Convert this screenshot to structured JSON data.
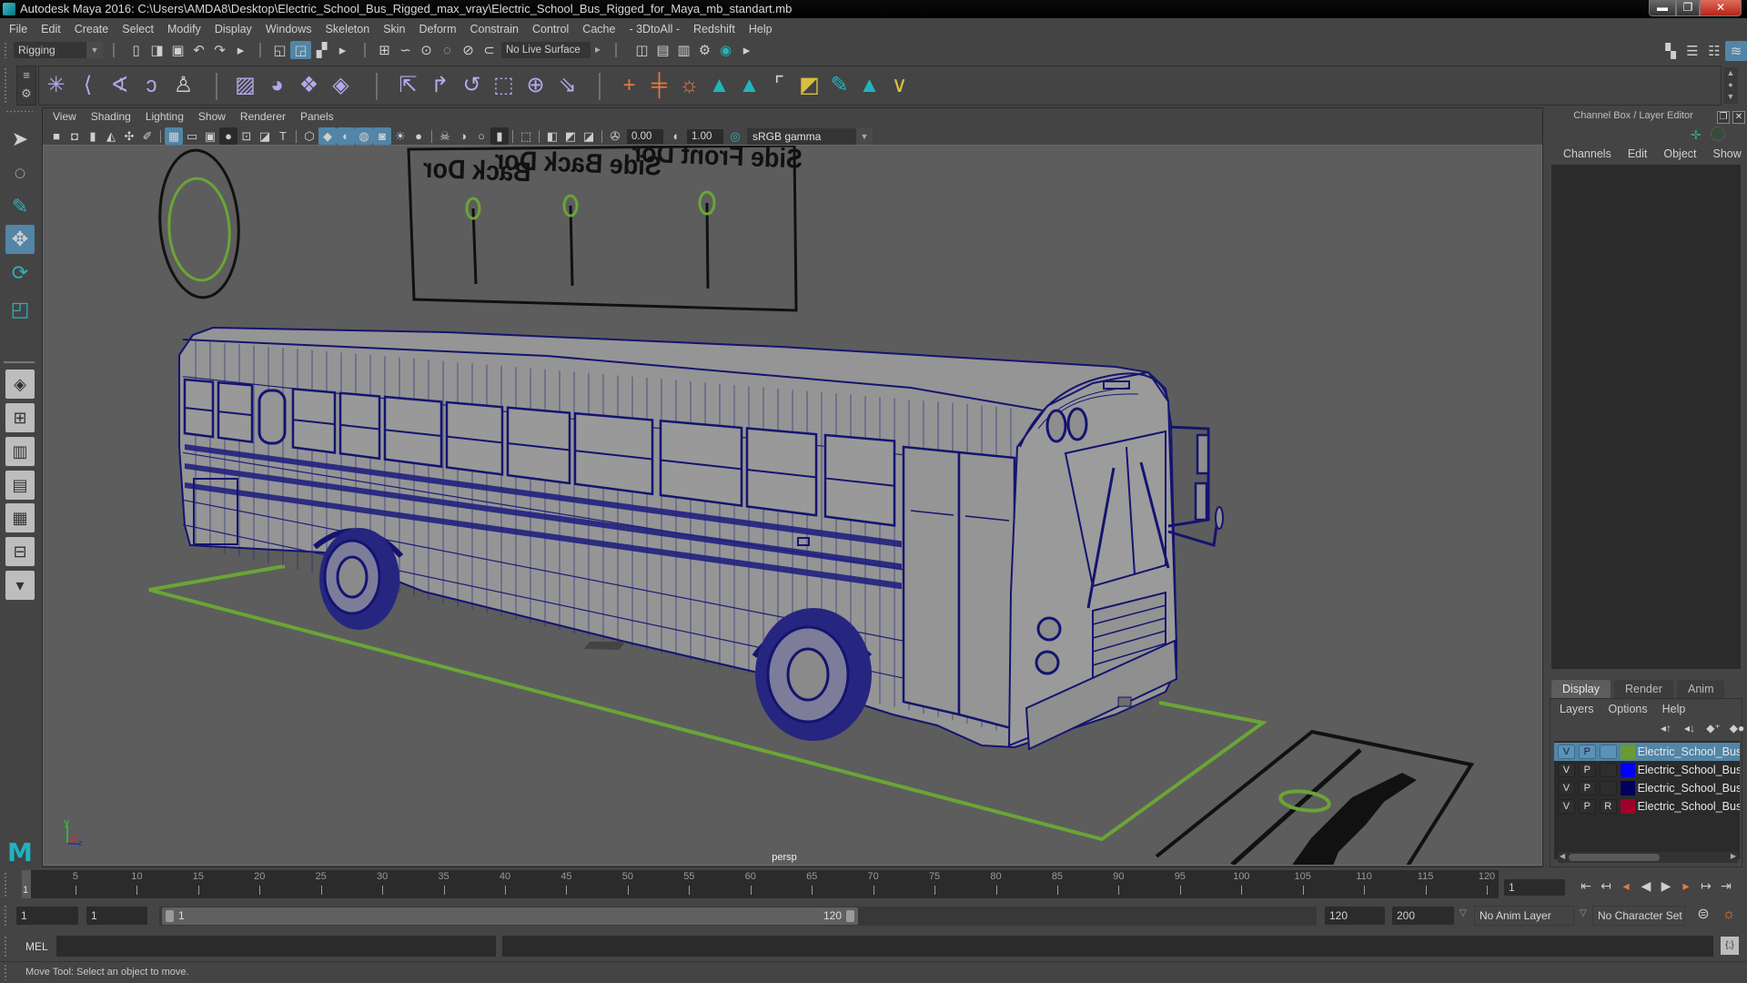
{
  "window": {
    "title": "Autodesk Maya 2016: C:\\Users\\AMDA8\\Desktop\\Electric_School_Bus_Rigged_max_vray\\Electric_School_Bus_Rigged_for_Maya_mb_standart.mb",
    "minimize": "▬",
    "restore": "❐",
    "close": "✕"
  },
  "menubar": [
    "File",
    "Edit",
    "Create",
    "Select",
    "Modify",
    "Display",
    "Windows",
    "Skeleton",
    "Skin",
    "Deform",
    "Constrain",
    "Control",
    "Cache",
    "- 3DtoAll -",
    "Redshift",
    "Help"
  ],
  "status_line": {
    "mode": "Rigging",
    "live_surface": "No Live Surface",
    "file_icons": [
      {
        "icon": "new-scene-icon",
        "tint": "gray"
      },
      {
        "icon": "open-scene-icon",
        "tint": "gray"
      },
      {
        "icon": "save-scene-icon",
        "tint": "gray"
      },
      {
        "icon": "undo-icon",
        "tint": "gray"
      },
      {
        "icon": "redo-icon",
        "tint": "gray"
      },
      {
        "icon": "expand-arrow-icon",
        "tint": "gray"
      }
    ],
    "select_icons": [
      {
        "icon": "select-by-hierarchy-icon",
        "tint": "gray"
      },
      {
        "icon": "select-by-object-icon",
        "tint": "gray",
        "active": true
      },
      {
        "icon": "select-by-component-icon",
        "tint": "gray"
      },
      {
        "icon": "expand-arrow-icon",
        "tint": "gray"
      }
    ],
    "snap_icons": [
      {
        "icon": "snap-to-grid-icon",
        "tint": "gray"
      },
      {
        "icon": "snap-to-curve-icon",
        "tint": "gray"
      },
      {
        "icon": "snap-to-point-icon",
        "tint": "gray"
      },
      {
        "icon": "snap-to-projected-center-icon",
        "tint": "gray"
      },
      {
        "icon": "snap-to-view-plane-icon",
        "tint": "gray"
      },
      {
        "icon": "make-live-icon",
        "tint": "gray"
      }
    ],
    "render_icons": [
      {
        "icon": "render-view-icon",
        "tint": "gray"
      },
      {
        "icon": "render-current-frame-icon",
        "tint": "gray"
      },
      {
        "icon": "ipr-render-icon",
        "tint": "gray"
      },
      {
        "icon": "render-settings-icon",
        "tint": "gray"
      },
      {
        "icon": "hypershade-icon",
        "tint": "teal"
      },
      {
        "icon": "expand-arrow-icon",
        "tint": "gray"
      }
    ],
    "panel_icons": [
      {
        "icon": "modeling-toolkit-icon",
        "tint": "gray"
      },
      {
        "icon": "attribute-editor-icon",
        "tint": "gray"
      },
      {
        "icon": "tool-settings-icon",
        "tint": "gray"
      },
      {
        "icon": "channel-box-layer-editor-icon",
        "tint": "gray",
        "active": true
      }
    ]
  },
  "shelf": {
    "tabs_icon": "≡",
    "settings_icon": "⚙",
    "group1": [
      {
        "icon": "create-joints-icon",
        "tint": "purple"
      },
      {
        "icon": "ik-handle-icon",
        "tint": "purple"
      },
      {
        "icon": "ik-spline-handle-icon",
        "tint": "purple"
      },
      {
        "icon": "insert-joint-icon",
        "tint": "purple"
      },
      {
        "icon": "humanik-icon",
        "tint": "gray"
      }
    ],
    "group2": [
      {
        "icon": "bind-skin-icon",
        "tint": "purple"
      },
      {
        "icon": "interactive-bind-skin-icon",
        "tint": "purple"
      },
      {
        "icon": "lattice-icon",
        "tint": "purple"
      },
      {
        "icon": "cluster-icon",
        "tint": "purple"
      }
    ],
    "group3": [
      {
        "icon": "parent-constraint-icon",
        "tint": "purple"
      },
      {
        "icon": "point-constraint-icon",
        "tint": "purple"
      },
      {
        "icon": "orient-constraint-icon",
        "tint": "purple"
      },
      {
        "icon": "scale-constraint-icon",
        "tint": "purple"
      },
      {
        "icon": "aim-constraint-icon",
        "tint": "purple"
      },
      {
        "icon": "pole-vector-constraint-icon",
        "tint": "purple"
      }
    ],
    "group4": [
      {
        "icon": "locator-icon",
        "tint": "orange"
      },
      {
        "icon": "parent-locator-icon",
        "tint": "orange"
      },
      {
        "icon": "character-control-icon",
        "tint": "orange"
      },
      {
        "icon": "mesh-tool-icon",
        "tint": "teal"
      },
      {
        "icon": "mesh-tool-2-icon",
        "tint": "teal"
      },
      {
        "icon": "empty-slot-icon",
        "tint": "gray"
      },
      {
        "icon": "layer-utility-icon",
        "tint": "yellow"
      },
      {
        "icon": "paint-tool-icon",
        "tint": "teal"
      },
      {
        "icon": "mesh-tool-3-icon",
        "tint": "teal"
      },
      {
        "icon": "vertex-tool-icon",
        "tint": "yellow"
      }
    ]
  },
  "toolbox": [
    {
      "icon": "select-tool-icon"
    },
    {
      "icon": "lasso-tool-icon"
    },
    {
      "icon": "paint-select-tool-icon"
    },
    {
      "icon": "move-tool-icon",
      "active": true
    },
    {
      "icon": "rotate-tool-icon"
    },
    {
      "icon": "scale-tool-icon"
    },
    {
      "icon": "single-perspective-layout-icon"
    },
    {
      "icon": "four-view-layout-icon"
    },
    {
      "icon": "outliner-persp-layout-icon"
    },
    {
      "icon": "graph-editor-persp-layout-icon"
    },
    {
      "icon": "hypershade-persp-layout-icon"
    },
    {
      "icon": "persp-graph-layout-icon"
    },
    {
      "icon": "more-layouts-icon"
    }
  ],
  "maya_logo": "M",
  "viewport": {
    "menu": [
      "View",
      "Shading",
      "Lighting",
      "Show",
      "Renderer",
      "Panels"
    ],
    "toolbar_icons": [
      {
        "icon": "select-camera-icon"
      },
      {
        "icon": "camera-attributes-icon"
      },
      {
        "icon": "bookmark-icon"
      },
      {
        "icon": "image-plane-icon"
      },
      {
        "icon": "2d-pan-zoom-icon"
      },
      {
        "icon": "grease-pencil-icon"
      },
      "|",
      {
        "icon": "grid-icon",
        "active": true
      },
      {
        "icon": "film-gate-icon"
      },
      {
        "icon": "resolution-gate-icon"
      },
      {
        "icon": "gate-mask-icon",
        "dark": true
      },
      {
        "icon": "field-chart-icon"
      },
      {
        "icon": "safe-action-icon"
      },
      {
        "icon": "safe-title-icon"
      },
      "|",
      {
        "icon": "wireframe-icon"
      },
      {
        "icon": "smooth-shade-icon",
        "active": true
      },
      {
        "icon": "default-material-icon",
        "active": true
      },
      {
        "icon": "wireframe-on-shaded-icon",
        "active": true
      },
      {
        "icon": "textured-icon",
        "active": true
      },
      {
        "icon": "use-all-lights-icon"
      },
      {
        "icon": "shadows-icon"
      },
      "|",
      {
        "icon": "screen-space-ao-icon"
      },
      {
        "icon": "motion-blur-icon"
      },
      {
        "icon": "anti-aliasing-icon"
      },
      {
        "icon": "depth-of-field-icon",
        "dark": true
      },
      "|",
      {
        "icon": "isolate-select-icon"
      },
      "|",
      {
        "icon": "xray-icon"
      },
      {
        "icon": "xray-active-components-icon"
      },
      {
        "icon": "xray-joints-icon"
      },
      "|",
      {
        "icon": "exposure-icon"
      },
      {
        "field": "exposure"
      },
      {
        "icon": "gamma-icon"
      },
      {
        "field": "gamma"
      },
      {
        "icon": "color-management-toggle-icon",
        "tint": "teal"
      },
      {
        "dropdown": "color_space"
      }
    ],
    "exposure": "0.00",
    "gamma": "1.00",
    "color_space": "sRGB gamma",
    "camera_label": "persp",
    "axis": {
      "x": "x",
      "y": "y",
      "z": "z"
    },
    "rig_labels": [
      "Side Front Dor",
      "Side Back Dor",
      "Back Dor"
    ]
  },
  "channel_box": {
    "title": "Channel Box / Layer Editor",
    "menu": [
      "Channels",
      "Edit",
      "Object",
      "Show"
    ],
    "tabs": [
      {
        "label": "Display",
        "active": true
      },
      {
        "label": "Render"
      },
      {
        "label": "Anim"
      }
    ],
    "layer_menu": [
      "Layers",
      "Options",
      "Help"
    ],
    "layer_icons": [
      {
        "icon": "move-layer-up-icon"
      },
      {
        "icon": "move-layer-down-icon"
      },
      {
        "icon": "new-empty-layer-icon"
      },
      {
        "icon": "new-layer-from-selected-icon"
      }
    ],
    "layers": [
      {
        "v": "V",
        "p": "P",
        "r": "",
        "color": "#6a9a33",
        "name": "Electric_School_Bus_Ri",
        "selected": true
      },
      {
        "v": "V",
        "p": "P",
        "r": "",
        "color": "#0000ff",
        "name": "Electric_School_Bus_Ri"
      },
      {
        "v": "V",
        "p": "P",
        "r": "",
        "color": "#00005c",
        "name": "Electric_School_Bus_Ri"
      },
      {
        "v": "V",
        "p": "P",
        "r": "R",
        "color": "#a00028",
        "name": "Electric_School_Bus_Ri"
      }
    ]
  },
  "timeline": {
    "first_frame": 1,
    "last_frame": 120,
    "tick_labels": [
      5,
      10,
      15,
      20,
      25,
      30,
      35,
      40,
      45,
      50,
      55,
      60,
      65,
      70,
      75,
      80,
      85,
      90,
      95,
      100,
      105,
      110,
      115,
      120
    ],
    "current_frame": "1",
    "current_frame_field": "1",
    "playback_icons": [
      {
        "icon": "go-to-start-icon"
      },
      {
        "icon": "step-back-key-icon"
      },
      {
        "icon": "step-back-frame-icon",
        "key": true
      },
      {
        "icon": "play-backwards-icon"
      },
      {
        "icon": "play-forwards-icon"
      },
      {
        "icon": "step-forward-frame-icon",
        "key": true
      },
      {
        "icon": "step-forward-key-icon"
      },
      {
        "icon": "go-to-end-icon"
      }
    ]
  },
  "range": {
    "start": "1",
    "anim_start": "1",
    "range_start": "1",
    "range_end": "120",
    "end": "120",
    "anim_end": "200",
    "anim_layer": "No Anim Layer",
    "character_set": "No Character Set",
    "icons": [
      {
        "icon": "auto-key-icon"
      },
      {
        "icon": "animation-preferences-icon",
        "tint": "orange"
      }
    ]
  },
  "command_line": {
    "language": "MEL",
    "input": "",
    "result": "",
    "script_editor_icon": "{;}"
  },
  "help_line": "Move Tool: Select an object to move."
}
